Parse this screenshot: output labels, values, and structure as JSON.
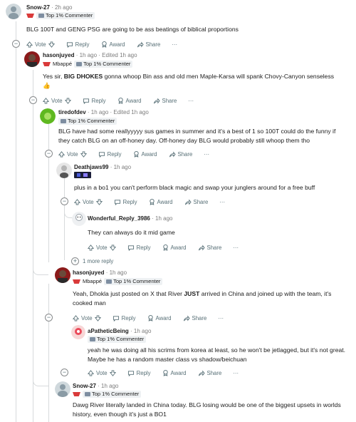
{
  "comments": [
    {
      "user": "Snow-27",
      "time": "2h ago",
      "edited": "",
      "flair": {
        "text": "Top 1% Commenter",
        "prefix": ""
      },
      "body": "BLG 100T and GENG PSG are going to be ass beatings of biblical proportions"
    },
    {
      "user": "hasonjuyed",
      "time": "1h ago",
      "edited": "Edited 1h ago",
      "flair": {
        "text": "Top 1% Commenter",
        "prefix": "Mbappé"
      },
      "body_pre": "Yes sir, ",
      "body_bold": "BIG DHOKES",
      "body_post": " gonna whoop Bin ass and old men Maple-Karsa will spank Chovy-Canyon senseless",
      "body_emoji": "👍"
    },
    {
      "user": "tiredofdev",
      "time": "1h ago",
      "edited": "Edited 1h ago",
      "flair": {
        "text": "Top 1% Commenter",
        "prefix": ""
      },
      "body": "BLG have had some reallyyyyy sus games in summer and it's a best of 1 so 100T could do the funny if they catch BLG on an off-honey day. Off-honey day BLG would probably still whoop them tho"
    },
    {
      "user": "Deathjaws99",
      "time": "1h ago",
      "edited": "",
      "flair": {
        "text": "",
        "prefix": ""
      },
      "body": "plus in a bo1 you can't perform black magic and swap your junglers around for a free buff"
    },
    {
      "user": "Wonderful_Reply_3986",
      "time": "1h ago",
      "edited": "",
      "flair": {
        "text": "",
        "prefix": ""
      },
      "body": "They can always do it mid game"
    },
    {
      "user": "hasonjuyed",
      "time": "1h ago",
      "edited": "",
      "flair": {
        "text": "Top 1% Commenter",
        "prefix": "Mbappé"
      },
      "body_pre": "Yeah, Dhokla just posted on X that River ",
      "body_bold": "JUST",
      "body_post": " arrived in China and joined up with the team, it's cooked man"
    },
    {
      "user": "aPatheticBeing",
      "time": "1h ago",
      "edited": "",
      "flair": {
        "text": "Top 1% Commenter",
        "prefix": ""
      },
      "body": "yeah he was doing all his scrims from korea at least, so he won't be jetlagged, but it's not great. Maybe he has a random master class vs shadow/beichuan"
    },
    {
      "user": "Snow-27",
      "time": "1h ago",
      "edited": "",
      "flair": {
        "text": "Top 1% Commenter",
        "prefix": ""
      },
      "body": "Dawg River literally landed in China today. BLG losing would be one of the biggest upsets in worlds history, even though it's just a BO1"
    }
  ],
  "actions": {
    "vote": "Vote",
    "reply": "Reply",
    "award": "Award",
    "share": "Share"
  },
  "more_replies": "1 more reply",
  "colors": {
    "accent": "#d93a3a",
    "meta": "#7c7c7c",
    "action": "#576f76",
    "thread": "#d7dadc"
  }
}
